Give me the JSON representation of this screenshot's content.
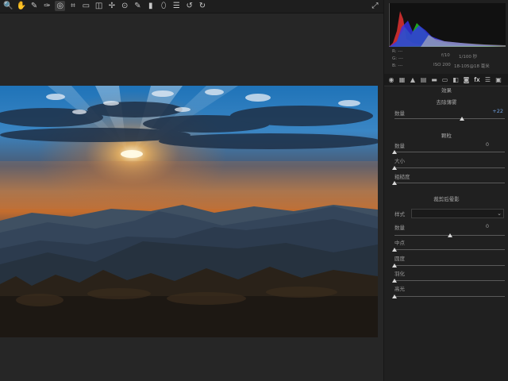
{
  "toolbar": {
    "tools": [
      {
        "name": "zoom-tool-icon",
        "glyph": "🔍"
      },
      {
        "name": "hand-tool-icon",
        "glyph": "✋"
      },
      {
        "name": "white-balance-tool-icon",
        "glyph": "✎"
      },
      {
        "name": "color-sampler-tool-icon",
        "glyph": "✑"
      },
      {
        "name": "target-adjustment-tool-icon",
        "glyph": "◎"
      },
      {
        "name": "crop-tool-icon",
        "glyph": "⌗"
      },
      {
        "name": "straighten-tool-icon",
        "glyph": "▭"
      },
      {
        "name": "transform-tool-icon",
        "glyph": "◫"
      },
      {
        "name": "spot-removal-tool-icon",
        "glyph": "✢"
      },
      {
        "name": "red-eye-tool-icon",
        "glyph": "⊙"
      },
      {
        "name": "adjustment-brush-icon",
        "glyph": "✎"
      },
      {
        "name": "graduated-filter-icon",
        "glyph": "▮"
      },
      {
        "name": "radial-filter-icon",
        "glyph": "⬯"
      },
      {
        "name": "preferences-icon",
        "glyph": "☰"
      },
      {
        "name": "rotate-left-icon",
        "glyph": "↺"
      },
      {
        "name": "rotate-right-icon",
        "glyph": "↻"
      }
    ],
    "fullscreen_icon": "⤢"
  },
  "histogram": {
    "rgb": {
      "r": "R:",
      "g": "G:",
      "b": "B:",
      "r_val": "---",
      "g_val": "---",
      "b_val": "---"
    },
    "exposure": {
      "aperture": "f/10",
      "shutter": "1/100 秒",
      "iso": "ISO 200",
      "lens": "18-105@18 毫米"
    }
  },
  "panel_tabs": [
    {
      "name": "basic-tab-icon",
      "glyph": "◉"
    },
    {
      "name": "tone-curve-tab-icon",
      "glyph": "▦"
    },
    {
      "name": "detail-tab-icon",
      "glyph": "▲"
    },
    {
      "name": "hsl-tab-icon",
      "glyph": "▤"
    },
    {
      "name": "split-toning-tab-icon",
      "glyph": "▬"
    },
    {
      "name": "lens-corrections-tab-icon",
      "glyph": "▭"
    },
    {
      "name": "transform-tab-icon",
      "glyph": "◧"
    },
    {
      "name": "camera-calibration-tab-icon",
      "glyph": "◙"
    },
    {
      "name": "effects-tab-icon",
      "glyph": "fx"
    },
    {
      "name": "presets-tab-icon",
      "glyph": "☰"
    },
    {
      "name": "snapshots-tab-icon",
      "glyph": "▣"
    }
  ],
  "effects": {
    "title": "效果",
    "dehaze": {
      "title": "去除薄雾",
      "amount_label": "数量",
      "amount_value": "+22",
      "amount_fraction": 0.61
    },
    "grain": {
      "title": "颗粒",
      "amount_label": "数量",
      "amount_value": "0",
      "amount_fraction": 0.0,
      "size_label": "大小",
      "size_fraction": 0.0,
      "roughness_label": "粗糙度",
      "roughness_fraction": 0.0
    },
    "vignette": {
      "title": "裁剪后晕影",
      "style_label": "样式",
      "style_value": "",
      "amount_label": "数量",
      "amount_value": "0",
      "amount_fraction": 0.5,
      "midpoint_label": "中点",
      "midpoint_fraction": 0.0,
      "roundness_label": "圆度",
      "roundness_fraction": 0.0,
      "feather_label": "羽化",
      "feather_fraction": 0.0,
      "highlights_label": "高光",
      "highlights_fraction": 0.0
    }
  }
}
